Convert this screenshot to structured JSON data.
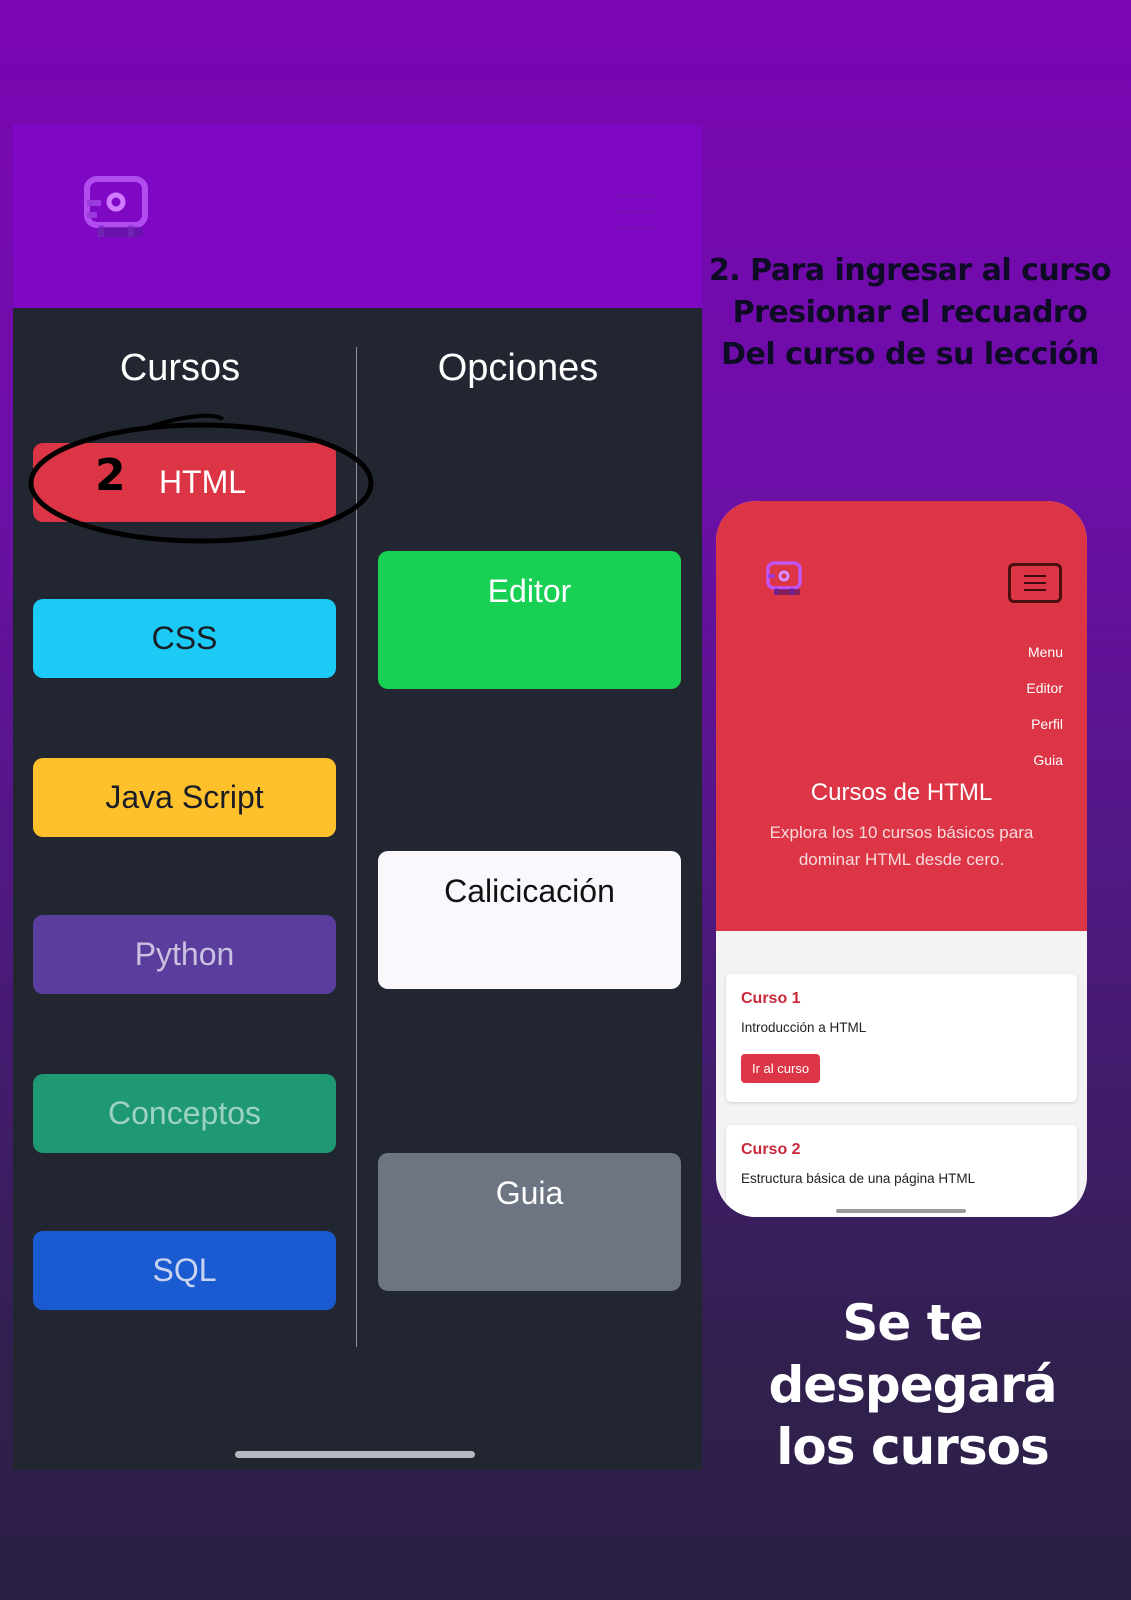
{
  "instruction": {
    "line1": "2. Para  ingresar al curso",
    "line2": "Presionar el recuadro",
    "line3": "Del curso  de su lección"
  },
  "caption": {
    "line1": "Se te despegará",
    "line2": "los cursos"
  },
  "app": {
    "courses_title": "Cursos",
    "options_title": "Opciones",
    "step_number": "2",
    "courses": [
      {
        "label": "HTML",
        "color": "#dc3545",
        "text_color": "#ffffff"
      },
      {
        "label": "CSS",
        "color": "#1bcaf5",
        "text_color": "#1b1d26"
      },
      {
        "label": "Java Script",
        "color": "#fec12c",
        "text_color": "#1b1d26"
      },
      {
        "label": "Python",
        "color": "#5a3d9c",
        "text_color": "#c9c1df"
      },
      {
        "label": "Conceptos",
        "color": "#1f9874",
        "text_color": "#9bd2c0"
      },
      {
        "label": "SQL",
        "color": "#1b5bd1",
        "text_color": "#c8d4ef"
      }
    ],
    "options": [
      {
        "label": "Editor",
        "color": "#18d154",
        "text_color": "#ffffff"
      },
      {
        "label": "Calicicación",
        "color": "#f9f8fd",
        "text_color": "#111111"
      },
      {
        "label": "Guia",
        "color": "#6d7583",
        "text_color": "#ffffff"
      }
    ]
  },
  "preview": {
    "nav": [
      "Menu",
      "Editor",
      "Perfil",
      "Guia"
    ],
    "title": "Cursos de HTML",
    "subtitle_line1": "Explora los 10 cursos básicos para",
    "subtitle_line2": "dominar HTML desde cero.",
    "cards": [
      {
        "title": "Curso 1",
        "text": "Introducción a HTML",
        "button": "Ir al curso"
      },
      {
        "title": "Curso 2",
        "text": "Estructura básica de una página HTML"
      }
    ]
  }
}
